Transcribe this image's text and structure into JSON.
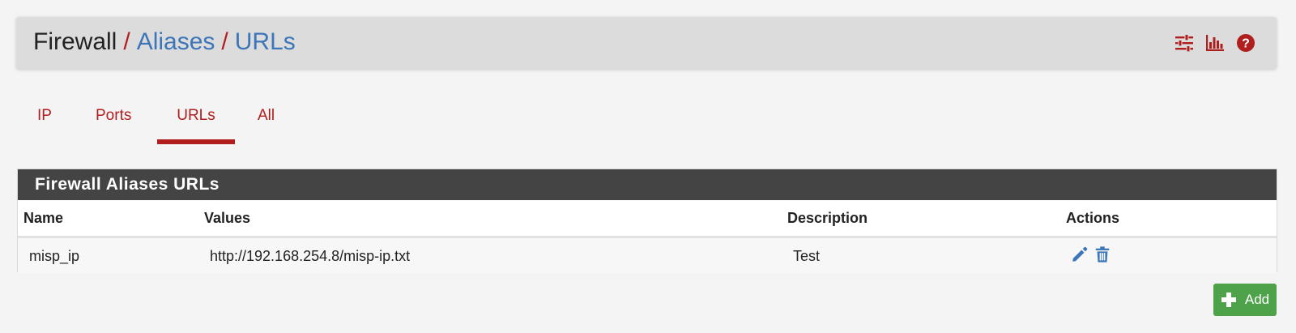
{
  "breadcrumb": {
    "home": "Firewall",
    "separator": "/",
    "items": [
      "Aliases",
      "URLs"
    ]
  },
  "header_icons": [
    "sliders-icon",
    "bar-chart-icon",
    "help-circle-icon"
  ],
  "tabs": [
    {
      "label": "IP",
      "active": false
    },
    {
      "label": "Ports",
      "active": false
    },
    {
      "label": "URLs",
      "active": true
    },
    {
      "label": "All",
      "active": false
    }
  ],
  "panel": {
    "title": "Firewall Aliases URLs",
    "columns": [
      "Name",
      "Values",
      "Description",
      "Actions"
    ],
    "rows": [
      {
        "name": "misp_ip",
        "values": "http://192.168.254.8/misp-ip.txt",
        "description": "Test",
        "actions": [
          "edit-icon",
          "delete-icon"
        ]
      }
    ]
  },
  "add_button": {
    "label": "Add",
    "icon": "plus-icon"
  },
  "colors": {
    "accent_red": "#b01e1e",
    "link_blue": "#3d76b8",
    "panel_heading": "#444444",
    "add_green": "#4ea24a",
    "action_blue": "#3d76b8"
  }
}
